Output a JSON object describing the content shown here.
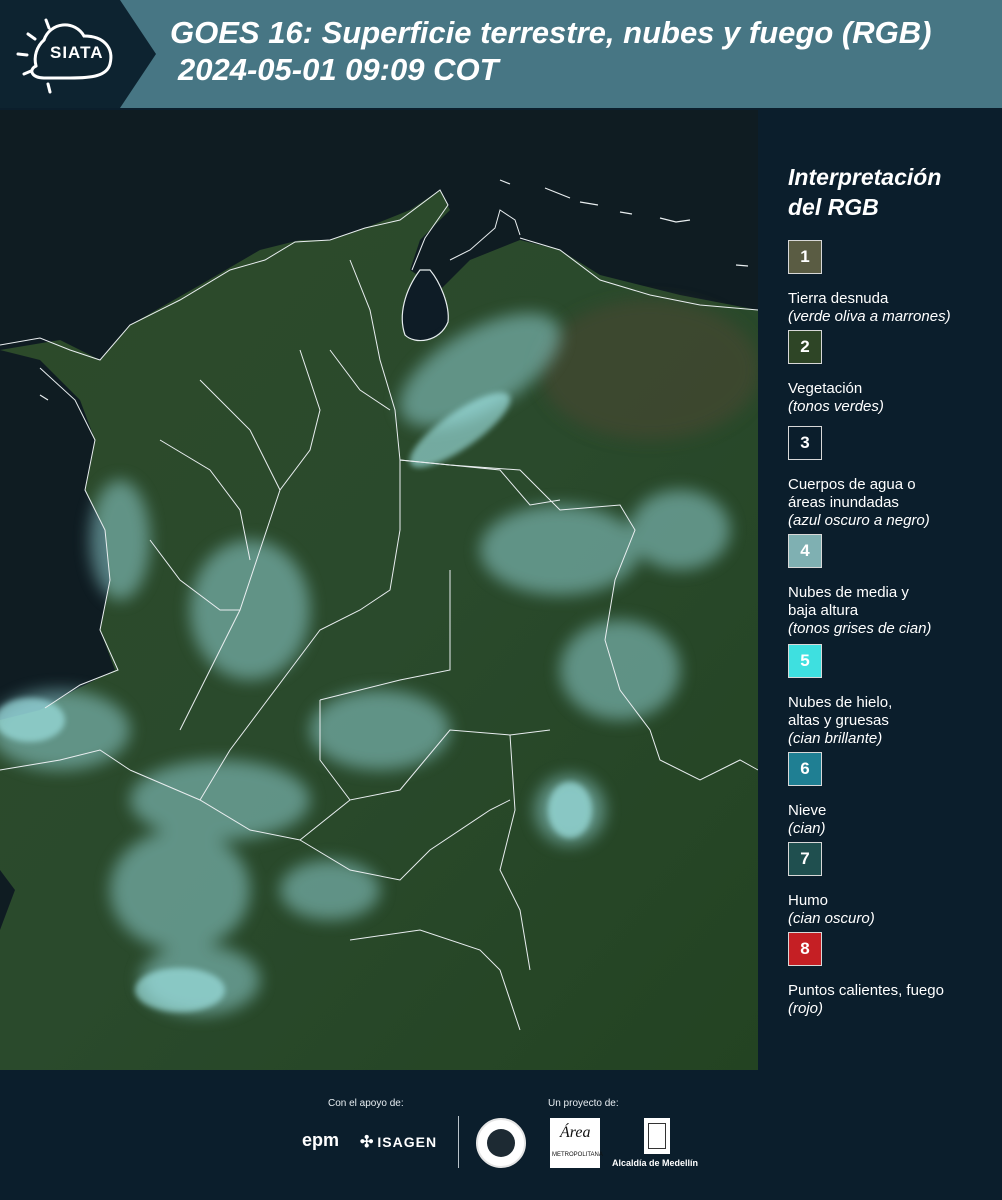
{
  "header": {
    "logo_text": "SIATA",
    "title_line1": "GOES 16: Superficie terrestre, nubes y fuego (RGB)",
    "title_line2": "2024-05-01 09:09 COT"
  },
  "legend": {
    "title_line1": "Interpretación",
    "title_line2": "del RGB",
    "items": [
      {
        "number": "1",
        "color": "#5a5c43",
        "label_line1": "Tierra desnuda",
        "label_line2": "",
        "sub": "(verde oliva a marrones)"
      },
      {
        "number": "2",
        "color": "#2e4526",
        "label_line1": "Vegetación",
        "label_line2": "",
        "sub": "(tonos verdes)"
      },
      {
        "number": "3",
        "color": "#0b1e2c",
        "label_line1": "Cuerpos de agua o",
        "label_line2": "áreas inundadas",
        "sub": "(azul oscuro a negro)"
      },
      {
        "number": "4",
        "color": "#7fb0b2",
        "label_line1": "Nubes de media y",
        "label_line2": "baja altura",
        "sub": "(tonos grises de cian)"
      },
      {
        "number": "5",
        "color": "#3ee0e0",
        "label_line1": "Nubes de hielo,",
        "label_line2": "altas y gruesas",
        "sub": "(cian brillante)"
      },
      {
        "number": "6",
        "color": "#1f7f93",
        "label_line1": "Nieve",
        "label_line2": "",
        "sub": "(cian)"
      },
      {
        "number": "7",
        "color": "#1f4f4f",
        "label_line1": "Humo",
        "label_line2": "",
        "sub": "(cian oscuro)"
      },
      {
        "number": "8",
        "color": "#c51f24",
        "label_line1": "Puntos calientes, fuego",
        "label_line2": "",
        "sub": "(rojo)"
      }
    ]
  },
  "footer": {
    "support_label": "Con el apoyo de:",
    "project_label": "Un proyecto de:",
    "epm": "epm",
    "isagen": "ISAGEN",
    "area_script": "Área",
    "area_text": "METROPOLITANA",
    "medellin": "Alcaldía de Medellín"
  }
}
